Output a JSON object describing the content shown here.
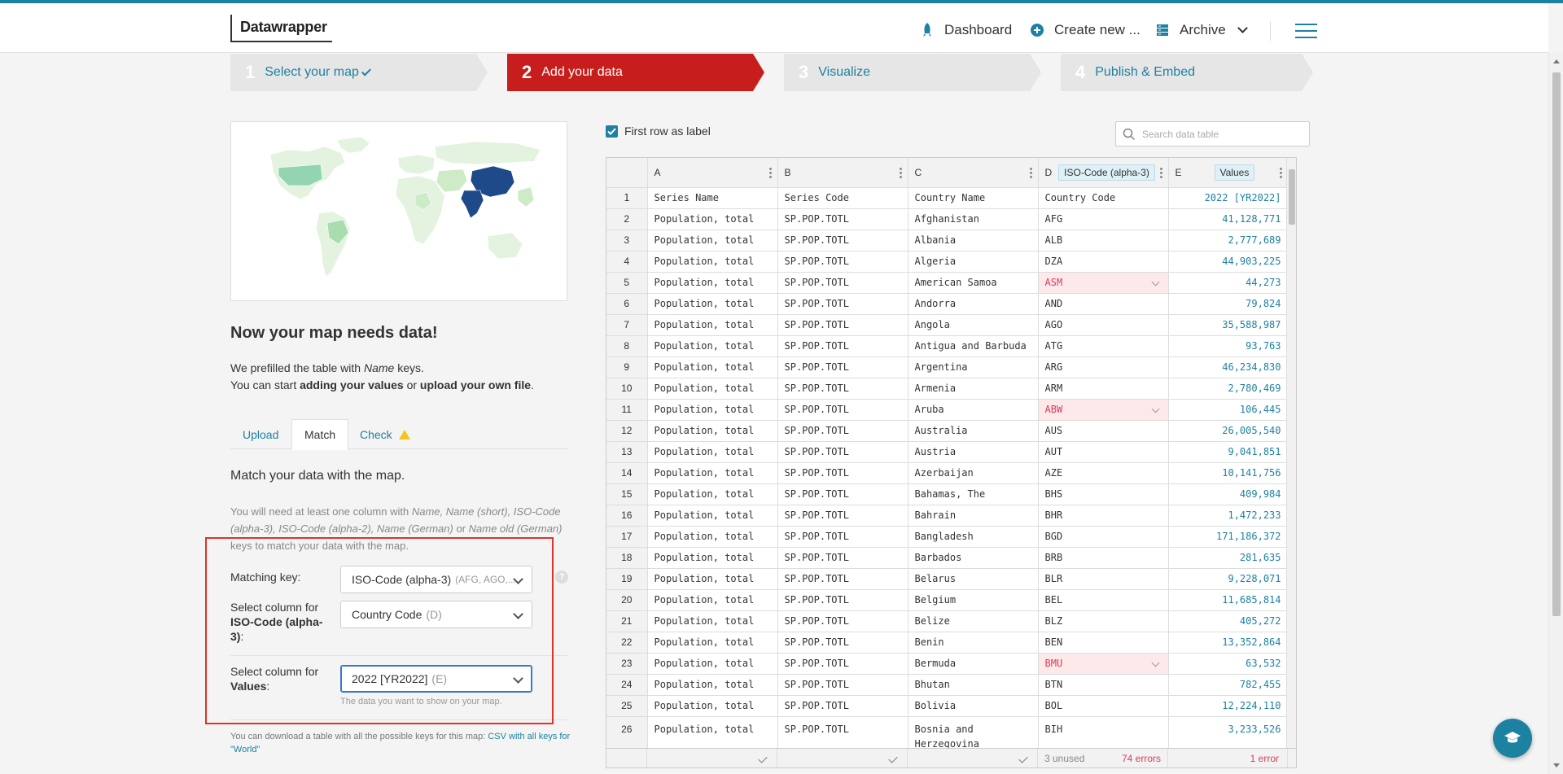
{
  "app": {
    "logo": "Datawrapper"
  },
  "nav": {
    "dashboard": "Dashboard",
    "create_new": "Create new ...",
    "archive": "Archive"
  },
  "steps": [
    {
      "num": "1",
      "label": "Select your map",
      "state": "done"
    },
    {
      "num": "2",
      "label": "Add your data",
      "state": "active"
    },
    {
      "num": "3",
      "label": "Visualize",
      "state": "inactive"
    },
    {
      "num": "4",
      "label": "Publish & Embed",
      "state": "inactive"
    }
  ],
  "left": {
    "heading": "Now your map needs data!",
    "intro_line1_pre": "We prefilled the table with ",
    "intro_line1_em": "Name",
    "intro_line1_post": " keys.",
    "intro_line2_pre": "You can start ",
    "intro_line2_b1": "adding your values",
    "intro_line2_mid": " or ",
    "intro_line2_b2": "upload your own file",
    "intro_line2_post": ".",
    "tabs": {
      "upload": "Upload",
      "match": "Match",
      "check": "Check"
    },
    "match_title": "Match your data with the map.",
    "match_desc_1": "You will need at least one column with ",
    "match_desc_keys": "Name, Name (short), ISO-Code (alpha-3), ISO-Code (alpha-2), Name (German)",
    "match_desc_or": " or ",
    "match_desc_key_last": "Name old (German)",
    "match_desc_2": " keys to match your data with the map.",
    "matching_key_label": "Matching key:",
    "matching_key_value": "ISO-Code (alpha-3)",
    "matching_key_hint": "(AFG, AGO,...",
    "iso_col_label_pre": "Select column for",
    "iso_col_label_b": "ISO-Code (alpha-3)",
    "iso_col_label_post": ":",
    "iso_col_value": "Country Code",
    "iso_col_hint": "(D)",
    "values_col_label_pre": "Select column for",
    "values_col_label_b": "Values",
    "values_col_label_post": ":",
    "values_col_value": "2022 [YR2022]",
    "values_col_hint": "(E)",
    "values_help": "The data you want to show on your map.",
    "help_q": "?",
    "footnote_pre": "You can download a table with all the possible keys for this map: ",
    "footnote_link": "CSV with all keys for \"World\""
  },
  "right": {
    "first_row_label": "First row as label",
    "search_placeholder": "Search data table",
    "col_letters": [
      "A",
      "B",
      "C",
      "D",
      "E"
    ],
    "col_d_badge": "ISO-Code (alpha-3)",
    "col_e_badge": "Values",
    "header_row": {
      "n": "1",
      "a": "Series Name",
      "b": "Series Code",
      "c": "Country Name",
      "d": "Country Code",
      "e": "2022 [YR2022]"
    },
    "rows": [
      {
        "n": "2",
        "a": "Population, total",
        "b": "SP.POP.TOTL",
        "c": "Afghanistan",
        "d": "AFG",
        "e": "41,128,771",
        "err": false
      },
      {
        "n": "3",
        "a": "Population, total",
        "b": "SP.POP.TOTL",
        "c": "Albania",
        "d": "ALB",
        "e": "2,777,689",
        "err": false
      },
      {
        "n": "4",
        "a": "Population, total",
        "b": "SP.POP.TOTL",
        "c": "Algeria",
        "d": "DZA",
        "e": "44,903,225",
        "err": false
      },
      {
        "n": "5",
        "a": "Population, total",
        "b": "SP.POP.TOTL",
        "c": "American Samoa",
        "d": "ASM",
        "e": "44,273",
        "err": true
      },
      {
        "n": "6",
        "a": "Population, total",
        "b": "SP.POP.TOTL",
        "c": "Andorra",
        "d": "AND",
        "e": "79,824",
        "err": false
      },
      {
        "n": "7",
        "a": "Population, total",
        "b": "SP.POP.TOTL",
        "c": "Angola",
        "d": "AGO",
        "e": "35,588,987",
        "err": false
      },
      {
        "n": "8",
        "a": "Population, total",
        "b": "SP.POP.TOTL",
        "c": "Antigua and Barbuda",
        "d": "ATG",
        "e": "93,763",
        "err": false
      },
      {
        "n": "9",
        "a": "Population, total",
        "b": "SP.POP.TOTL",
        "c": "Argentina",
        "d": "ARG",
        "e": "46,234,830",
        "err": false
      },
      {
        "n": "10",
        "a": "Population, total",
        "b": "SP.POP.TOTL",
        "c": "Armenia",
        "d": "ARM",
        "e": "2,780,469",
        "err": false
      },
      {
        "n": "11",
        "a": "Population, total",
        "b": "SP.POP.TOTL",
        "c": "Aruba",
        "d": "ABW",
        "e": "106,445",
        "err": true
      },
      {
        "n": "12",
        "a": "Population, total",
        "b": "SP.POP.TOTL",
        "c": "Australia",
        "d": "AUS",
        "e": "26,005,540",
        "err": false
      },
      {
        "n": "13",
        "a": "Population, total",
        "b": "SP.POP.TOTL",
        "c": "Austria",
        "d": "AUT",
        "e": "9,041,851",
        "err": false
      },
      {
        "n": "14",
        "a": "Population, total",
        "b": "SP.POP.TOTL",
        "c": "Azerbaijan",
        "d": "AZE",
        "e": "10,141,756",
        "err": false
      },
      {
        "n": "15",
        "a": "Population, total",
        "b": "SP.POP.TOTL",
        "c": "Bahamas, The",
        "d": "BHS",
        "e": "409,984",
        "err": false
      },
      {
        "n": "16",
        "a": "Population, total",
        "b": "SP.POP.TOTL",
        "c": "Bahrain",
        "d": "BHR",
        "e": "1,472,233",
        "err": false
      },
      {
        "n": "17",
        "a": "Population, total",
        "b": "SP.POP.TOTL",
        "c": "Bangladesh",
        "d": "BGD",
        "e": "171,186,372",
        "err": false
      },
      {
        "n": "18",
        "a": "Population, total",
        "b": "SP.POP.TOTL",
        "c": "Barbados",
        "d": "BRB",
        "e": "281,635",
        "err": false
      },
      {
        "n": "19",
        "a": "Population, total",
        "b": "SP.POP.TOTL",
        "c": "Belarus",
        "d": "BLR",
        "e": "9,228,071",
        "err": false
      },
      {
        "n": "20",
        "a": "Population, total",
        "b": "SP.POP.TOTL",
        "c": "Belgium",
        "d": "BEL",
        "e": "11,685,814",
        "err": false
      },
      {
        "n": "21",
        "a": "Population, total",
        "b": "SP.POP.TOTL",
        "c": "Belize",
        "d": "BLZ",
        "e": "405,272",
        "err": false
      },
      {
        "n": "22",
        "a": "Population, total",
        "b": "SP.POP.TOTL",
        "c": "Benin",
        "d": "BEN",
        "e": "13,352,864",
        "err": false
      },
      {
        "n": "23",
        "a": "Population, total",
        "b": "SP.POP.TOTL",
        "c": "Bermuda",
        "d": "BMU",
        "e": "63,532",
        "err": true
      },
      {
        "n": "24",
        "a": "Population, total",
        "b": "SP.POP.TOTL",
        "c": "Bhutan",
        "d": "BTN",
        "e": "782,455",
        "err": false
      },
      {
        "n": "25",
        "a": "Population, total",
        "b": "SP.POP.TOTL",
        "c": "Bolivia",
        "d": "BOL",
        "e": "12,224,110",
        "err": false
      },
      {
        "n": "26",
        "a": "Population, total",
        "b": "SP.POP.TOTL",
        "c": "Bosnia and Herzegovina",
        "d": "BIH",
        "e": "3,233,526",
        "err": false
      }
    ],
    "footer": {
      "d_unused": "3 unused",
      "d_errors": "74 errors",
      "e_errors": "1 error"
    }
  },
  "colors": {
    "accent": "#1d81a2",
    "active_step": "#c71e1d",
    "error": "#d6405a",
    "highlight_box": "#e0312b"
  }
}
